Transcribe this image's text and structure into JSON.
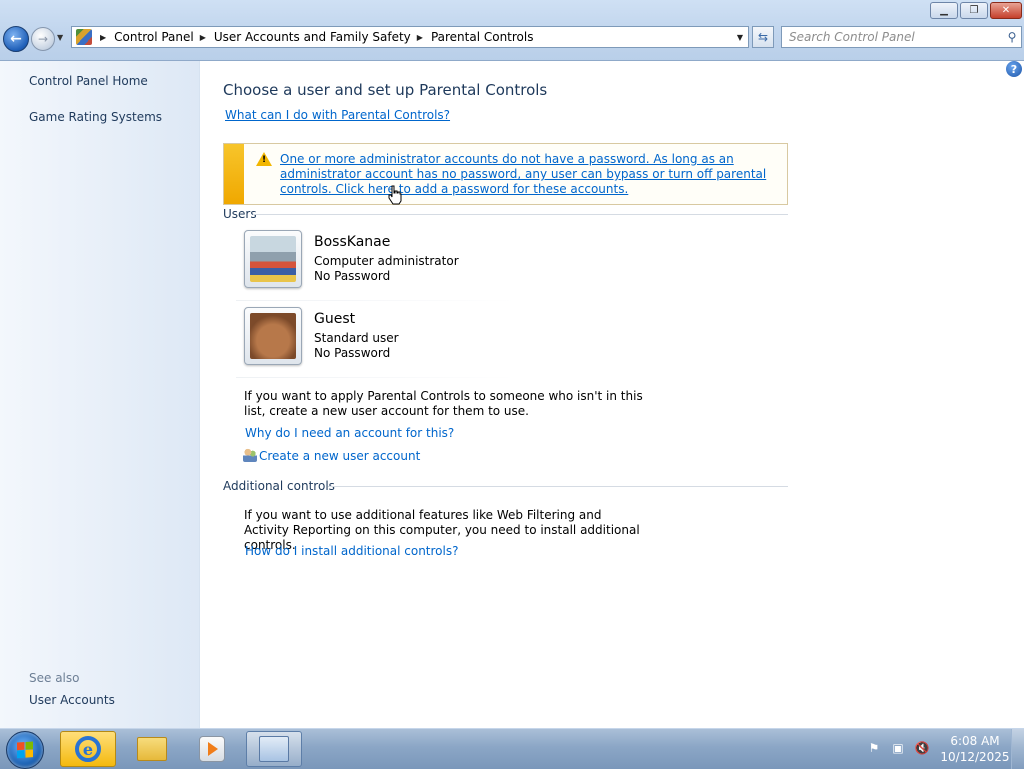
{
  "window": {
    "minimize_glyph": "▁",
    "maximize_glyph": "❐",
    "close_glyph": "✕"
  },
  "nav": {
    "back_glyph": "←",
    "forward_glyph": "→",
    "breadcrumb": [
      "Control Panel",
      "User Accounts and Family Safety",
      "Parental Controls"
    ],
    "search_placeholder": "Search Control Panel"
  },
  "sidebar": {
    "items": [
      {
        "label": "Control Panel Home"
      },
      {
        "label": "Game Rating Systems"
      }
    ],
    "see_also_label": "See also",
    "see_also_items": [
      {
        "label": "User Accounts"
      }
    ]
  },
  "main": {
    "title": "Choose a user and set up Parental Controls",
    "what_link": "What can I do with Parental Controls?",
    "warning_text": "One or more administrator accounts do not have a password. As long as an administrator account has no password, any user can bypass or turn off parental controls. Click here to add a password for these accounts.",
    "users_header": "Users",
    "users": [
      {
        "name": "BossKanae",
        "role": "Computer administrator",
        "password": "No Password",
        "avatar": "robot-avatar-icon"
      },
      {
        "name": "Guest",
        "role": "Standard user",
        "password": "No Password",
        "avatar": "briefcase-avatar-icon"
      }
    ],
    "not_in_list_text": "If you want to apply Parental Controls to someone who isn't in this list, create a new user account for them to use.",
    "why_link": "Why do I need an account for this?",
    "create_link": "Create a new user account",
    "additional_header": "Additional controls",
    "additional_text": "If you want to use additional features like Web Filtering and Activity Reporting on this computer, you need to install additional controls.",
    "install_link": "How do I install additional controls?"
  },
  "taskbar": {
    "time": "6:08 AM",
    "date": "10/12/2025",
    "pinned": [
      "internet-explorer-icon",
      "windows-explorer-icon",
      "media-player-icon",
      "control-panel-icon"
    ],
    "tray_icons": [
      "action-center-flag-icon",
      "network-icon",
      "volume-muted-icon"
    ]
  },
  "colors": {
    "link": "#0066cc",
    "heading": "#1e395b",
    "warning_stripe": "#f0a800"
  }
}
